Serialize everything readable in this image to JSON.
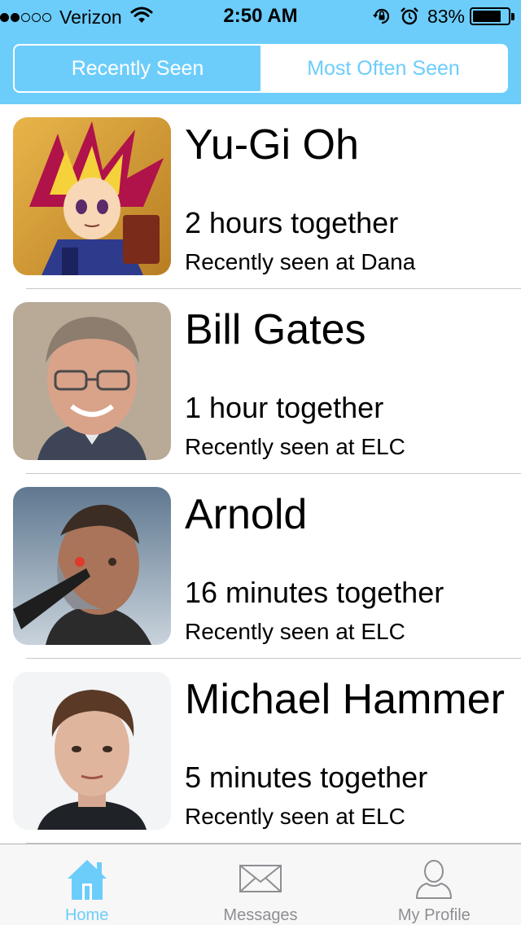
{
  "status_bar": {
    "carrier": "Verizon",
    "signal_bars": 2,
    "time": "2:50 AM",
    "battery_percent": "83%",
    "battery_level": 0.83,
    "icons": [
      "wifi-icon",
      "rotation-lock-icon",
      "alarm-icon",
      "battery-icon"
    ]
  },
  "segmented_control": {
    "segments": [
      {
        "label": "Recently Seen",
        "selected": true
      },
      {
        "label": "Most Often Seen",
        "selected": false
      }
    ]
  },
  "people": [
    {
      "name": "Yu-Gi Oh",
      "duration": "2 hours together",
      "location": "Recently seen at Dana",
      "avatar": "yugioh-avatar"
    },
    {
      "name": "Bill Gates",
      "duration": "1 hour together",
      "location": "Recently seen at ELC",
      "avatar": "bill-gates-avatar"
    },
    {
      "name": "Arnold",
      "duration": "16 minutes together",
      "location": "Recently seen at ELC",
      "avatar": "arnold-avatar"
    },
    {
      "name": "Michael Hammer",
      "duration": "5 minutes together",
      "location": "Recently seen at ELC",
      "avatar": "michael-hammer-avatar"
    }
  ],
  "tab_bar": {
    "tabs": [
      {
        "label": "Home",
        "icon": "home-icon",
        "active": true
      },
      {
        "label": "Messages",
        "icon": "envelope-icon",
        "active": false
      },
      {
        "label": "My Profile",
        "icon": "person-icon",
        "active": false
      }
    ]
  },
  "colors": {
    "accent": "#6ccdfb",
    "tab_inactive": "#8e8e93",
    "divider": "#c8c7cc"
  }
}
